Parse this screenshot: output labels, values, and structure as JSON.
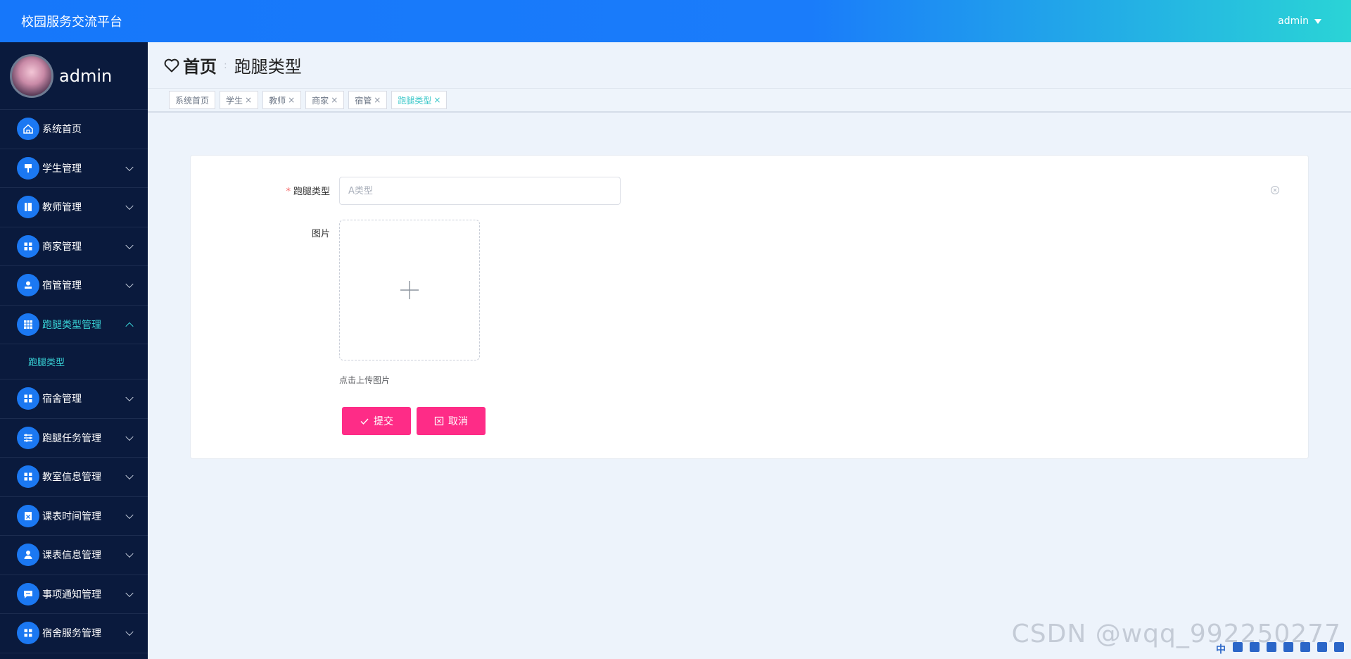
{
  "topbar": {
    "title": "校园服务交流平台",
    "user": "admin"
  },
  "sidebar": {
    "username": "admin",
    "items": [
      {
        "label": "系统首页",
        "icon": "home-icon",
        "hasChildren": false
      },
      {
        "label": "学生管理",
        "icon": "podium-icon",
        "hasChildren": true
      },
      {
        "label": "教师管理",
        "icon": "book-icon",
        "hasChildren": true
      },
      {
        "label": "商家管理",
        "icon": "grid-icon",
        "hasChildren": true
      },
      {
        "label": "宿管管理",
        "icon": "user-stamp-icon",
        "hasChildren": true
      },
      {
        "label": "跑腿类型管理",
        "icon": "table-icon",
        "hasChildren": true,
        "active": true,
        "expanded": true
      },
      {
        "label": "宿舍管理",
        "icon": "grid-icon",
        "hasChildren": true
      },
      {
        "label": "跑腿任务管理",
        "icon": "sliders-icon",
        "hasChildren": true
      },
      {
        "label": "教室信息管理",
        "icon": "grid-icon",
        "hasChildren": true
      },
      {
        "label": "课表时间管理",
        "icon": "clipboard-icon",
        "hasChildren": true
      },
      {
        "label": "课表信息管理",
        "icon": "person-icon",
        "hasChildren": true
      },
      {
        "label": "事项通知管理",
        "icon": "chat-icon",
        "hasChildren": true
      },
      {
        "label": "宿舍服务管理",
        "icon": "grid-icon",
        "hasChildren": true
      }
    ],
    "subitem": "跑腿类型"
  },
  "header": {
    "home": "首页",
    "current": "跑腿类型"
  },
  "tags": [
    {
      "label": "系统首页",
      "closable": false
    },
    {
      "label": "学生",
      "closable": true
    },
    {
      "label": "教师",
      "closable": true
    },
    {
      "label": "商家",
      "closable": true
    },
    {
      "label": "宿管",
      "closable": true
    },
    {
      "label": "跑腿类型",
      "closable": true,
      "active": true
    }
  ],
  "form": {
    "type_label": "跑腿类型",
    "type_placeholder": "A类型",
    "image_label": "图片",
    "upload_tip": "点击上传图片",
    "submit": "提交",
    "cancel": "取消"
  },
  "watermark": "CSDN @wqq_992250277",
  "tray": {
    "ime": "中"
  },
  "colors": {
    "accent": "#1b78f2",
    "active": "#38d2d6",
    "button": "#fe2c87",
    "sidebar": "#0a1a3d"
  }
}
